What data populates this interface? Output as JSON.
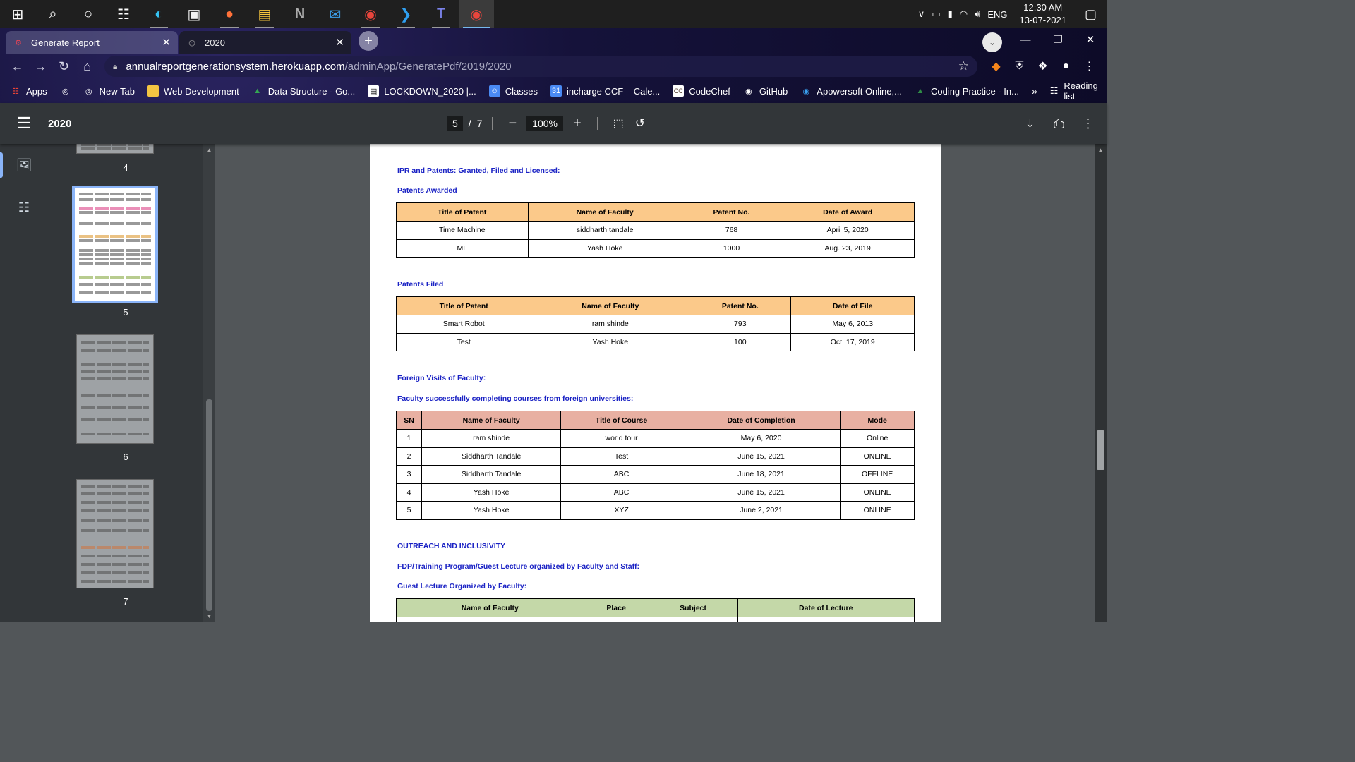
{
  "taskbar": {
    "icons": [
      "windows-start-icon",
      "search-icon",
      "cortana-icon",
      "task-view-icon",
      "edge-icon",
      "store-icon",
      "firefox-icon",
      "file-explorer-icon",
      "notion-icon",
      "mail-icon",
      "chrome-icon",
      "vscode-icon",
      "teams-icon",
      "chrome-active-icon"
    ],
    "language": "ENG",
    "time": "12:30 AM",
    "date": "13-07-2021"
  },
  "browser": {
    "tabs": [
      {
        "title": "Generate Report",
        "active": false
      },
      {
        "title": "2020",
        "active": true
      }
    ],
    "url_host": "annualreportgenerationsystem.herokuapp.com",
    "url_path": "/adminApp/GeneratePdf/2019/2020",
    "bookmarks": [
      "Apps",
      "",
      "New Tab",
      "Web Development",
      "Data Structure - Go...",
      "LOCKDOWN_2020 |...",
      "Classes",
      "incharge CCF – Cale...",
      "CodeChef",
      "GitHub",
      "Apowersoft Online,...",
      "Coding Practice - In..."
    ],
    "more": "»",
    "reading_list": "Reading list"
  },
  "pdf_toolbar": {
    "title": "2020",
    "current_page": "5",
    "page_sep": "/",
    "total_pages": "7",
    "zoom": "100%"
  },
  "thumbnails": [
    "4",
    "5",
    "6",
    "7"
  ],
  "page": {
    "h_ipr": "IPR and Patents: Granted, Filed and Licensed:",
    "h_awarded": "Patents Awarded",
    "awarded_headers": [
      "Title of Patent",
      "Name of Faculty",
      "Patent No.",
      "Date of Award"
    ],
    "awarded_rows": [
      [
        "Time Machine",
        "siddharth tandale",
        "768",
        "April 5, 2020"
      ],
      [
        "ML",
        "Yash Hoke",
        "1000",
        "Aug. 23, 2019"
      ]
    ],
    "h_filed": "Patents Filed",
    "filed_headers": [
      "Title of Patent",
      "Name of Faculty",
      "Patent No.",
      "Date of File"
    ],
    "filed_rows": [
      [
        "Smart Robot",
        "ram shinde",
        "793",
        "May 6, 2013"
      ],
      [
        "Test",
        "Yash Hoke",
        "100",
        "Oct. 17, 2019"
      ]
    ],
    "h_foreign": "Foreign Visits of Faculty:",
    "h_courses": "Faculty successfully completing courses from foreign universities:",
    "courses_headers": [
      "SN",
      "Name of Faculty",
      "Title of Course",
      "Date of Completion",
      "Mode"
    ],
    "courses_rows": [
      [
        "1",
        "ram shinde",
        "world tour",
        "May 6, 2020",
        "Online"
      ],
      [
        "2",
        "Siddharth Tandale",
        "Test",
        "June 15, 2021",
        "ONLINE"
      ],
      [
        "3",
        "Siddharth Tandale",
        "ABC",
        "June 18, 2021",
        "OFFLINE"
      ],
      [
        "4",
        "Yash Hoke",
        "ABC",
        "June 15, 2021",
        "ONLINE"
      ],
      [
        "5",
        "Yash Hoke",
        "XYZ",
        "June 2, 2021",
        "ONLINE"
      ]
    ],
    "h_outreach": "OUTREACH AND INCLUSIVITY",
    "h_fdp": "FDP/Training Program/Guest Lecture organized by Faculty and Staff:",
    "h_guest": "Guest Lecture Organized by Faculty:",
    "guest_headers": [
      "Name of Faculty",
      "Place",
      "Subject",
      "Date of Lecture"
    ]
  }
}
